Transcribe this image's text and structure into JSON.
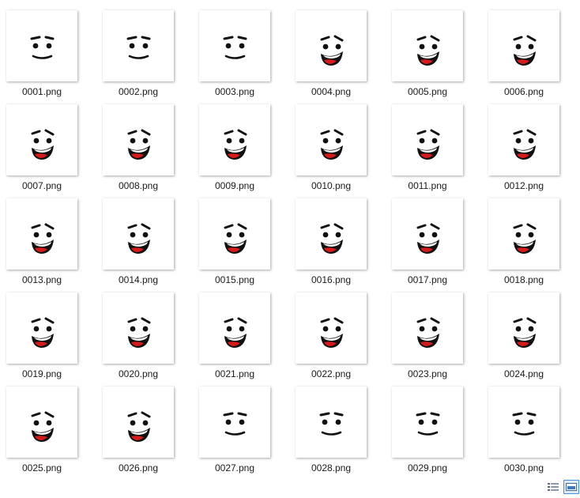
{
  "files": [
    {
      "name": "0001.png",
      "expression": "smile"
    },
    {
      "name": "0002.png",
      "expression": "smile"
    },
    {
      "name": "0003.png",
      "expression": "smile"
    },
    {
      "name": "0004.png",
      "expression": "laugh"
    },
    {
      "name": "0005.png",
      "expression": "laugh"
    },
    {
      "name": "0006.png",
      "expression": "laugh"
    },
    {
      "name": "0007.png",
      "expression": "laugh"
    },
    {
      "name": "0008.png",
      "expression": "laugh"
    },
    {
      "name": "0009.png",
      "expression": "laugh"
    },
    {
      "name": "0010.png",
      "expression": "laugh"
    },
    {
      "name": "0011.png",
      "expression": "laugh"
    },
    {
      "name": "0012.png",
      "expression": "laugh"
    },
    {
      "name": "0013.png",
      "expression": "laugh"
    },
    {
      "name": "0014.png",
      "expression": "laugh"
    },
    {
      "name": "0015.png",
      "expression": "laugh"
    },
    {
      "name": "0016.png",
      "expression": "laugh"
    },
    {
      "name": "0017.png",
      "expression": "laugh"
    },
    {
      "name": "0018.png",
      "expression": "laugh"
    },
    {
      "name": "0019.png",
      "expression": "laugh"
    },
    {
      "name": "0020.png",
      "expression": "laugh"
    },
    {
      "name": "0021.png",
      "expression": "laugh"
    },
    {
      "name": "0022.png",
      "expression": "laugh"
    },
    {
      "name": "0023.png",
      "expression": "laugh"
    },
    {
      "name": "0024.png",
      "expression": "laugh"
    },
    {
      "name": "0025.png",
      "expression": "laugh"
    },
    {
      "name": "0026.png",
      "expression": "laugh"
    },
    {
      "name": "0027.png",
      "expression": "smile"
    },
    {
      "name": "0028.png",
      "expression": "smile"
    },
    {
      "name": "0029.png",
      "expression": "smile"
    },
    {
      "name": "0030.png",
      "expression": "smile"
    }
  ],
  "status_bar": {
    "view_buttons": [
      {
        "icon": "details-view-icon",
        "selected": false
      },
      {
        "icon": "large-icons-view-icon",
        "selected": true
      }
    ]
  },
  "colors": {
    "face_ink": "#111111",
    "mouth_red": "#d41a1a",
    "teeth": "#ffffff",
    "selected_view_border": "#4a90d9",
    "selected_view_fill": "#dbeaf8"
  }
}
